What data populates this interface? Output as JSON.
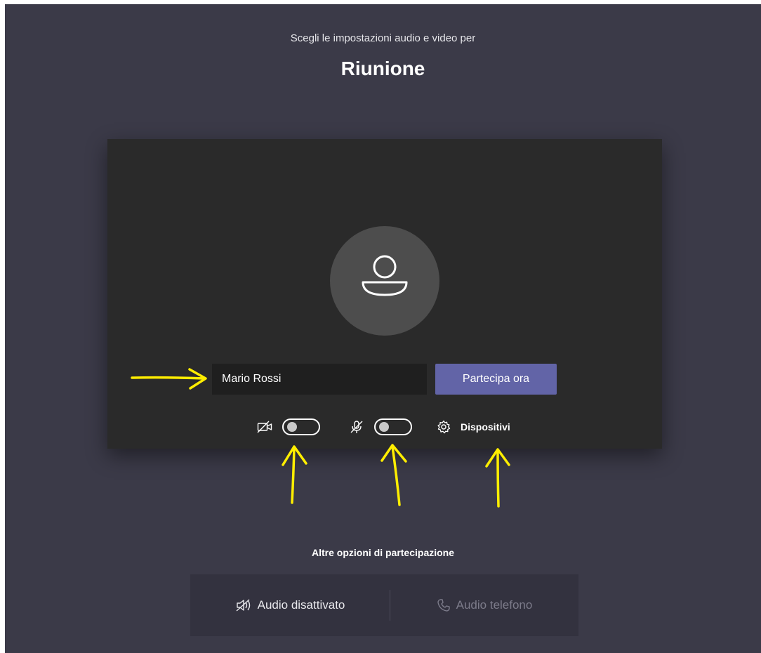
{
  "header": {
    "subtitle": "Scegli le impostazioni audio e video per",
    "title": "Riunione"
  },
  "preview": {
    "avatar_icon": "person-icon",
    "name_value": "Mario Rossi",
    "join_label": "Partecipa ora",
    "camera_toggle": {
      "icon": "camera-off-icon",
      "state": "off"
    },
    "mic_toggle": {
      "icon": "mic-off-icon",
      "state": "off"
    },
    "devices_label": "Dispositivi",
    "devices_icon": "gear-icon"
  },
  "more_options": {
    "title": "Altre opzioni di partecipazione",
    "audio_off_label": "Audio disattivato",
    "audio_off_icon": "speaker-off-icon",
    "phone_audio_label": "Audio telefono",
    "phone_audio_icon": "phone-icon"
  },
  "colors": {
    "background": "#3b3a48",
    "preview_bg": "#2a2a2a",
    "accent": "#6264a7",
    "annotation": "#ffee00"
  }
}
